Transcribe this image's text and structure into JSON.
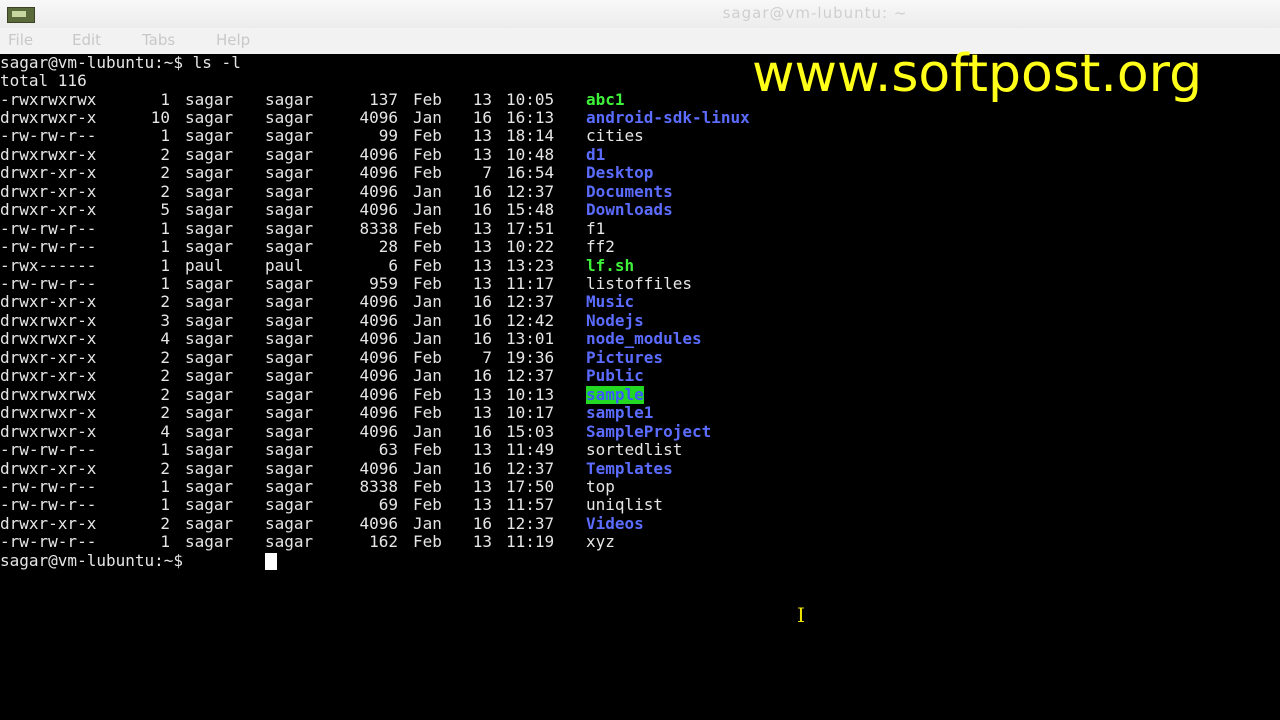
{
  "window": {
    "title": "sagar@vm-lubuntu: ~",
    "menu": [
      "File",
      "Edit",
      "Tabs",
      "Help"
    ]
  },
  "terminal": {
    "prompt_line": "sagar@vm-lubuntu:~$ ls -l",
    "total_line": "total 116",
    "entries": [
      {
        "perm": "-rwxrwxrwx",
        "links": "1",
        "owner": "sagar",
        "group": "sagar",
        "size": "137",
        "month": "Feb",
        "day": "13",
        "time": "10:05",
        "name": "abc1",
        "type": "exec"
      },
      {
        "perm": "drwxrwxr-x",
        "links": "10",
        "owner": "sagar",
        "group": "sagar",
        "size": "4096",
        "month": "Jan",
        "day": "16",
        "time": "16:13",
        "name": "android-sdk-linux",
        "type": "dir"
      },
      {
        "perm": "-rw-rw-r--",
        "links": "1",
        "owner": "sagar",
        "group": "sagar",
        "size": "99",
        "month": "Feb",
        "day": "13",
        "time": "18:14",
        "name": "cities",
        "type": "file"
      },
      {
        "perm": "drwxrwxr-x",
        "links": "2",
        "owner": "sagar",
        "group": "sagar",
        "size": "4096",
        "month": "Feb",
        "day": "13",
        "time": "10:48",
        "name": "d1",
        "type": "dir"
      },
      {
        "perm": "drwxr-xr-x",
        "links": "2",
        "owner": "sagar",
        "group": "sagar",
        "size": "4096",
        "month": "Feb",
        "day": "7",
        "time": "16:54",
        "name": "Desktop",
        "type": "dir"
      },
      {
        "perm": "drwxr-xr-x",
        "links": "2",
        "owner": "sagar",
        "group": "sagar",
        "size": "4096",
        "month": "Jan",
        "day": "16",
        "time": "12:37",
        "name": "Documents",
        "type": "dir"
      },
      {
        "perm": "drwxr-xr-x",
        "links": "5",
        "owner": "sagar",
        "group": "sagar",
        "size": "4096",
        "month": "Jan",
        "day": "16",
        "time": "15:48",
        "name": "Downloads",
        "type": "dir"
      },
      {
        "perm": "-rw-rw-r--",
        "links": "1",
        "owner": "sagar",
        "group": "sagar",
        "size": "8338",
        "month": "Feb",
        "day": "13",
        "time": "17:51",
        "name": "f1",
        "type": "file"
      },
      {
        "perm": "-rw-rw-r--",
        "links": "1",
        "owner": "sagar",
        "group": "sagar",
        "size": "28",
        "month": "Feb",
        "day": "13",
        "time": "10:22",
        "name": "ff2",
        "type": "file"
      },
      {
        "perm": "-rwx------",
        "links": "1",
        "owner": "paul",
        "group": "paul",
        "size": "6",
        "month": "Feb",
        "day": "13",
        "time": "13:23",
        "name": "lf.sh",
        "type": "exec"
      },
      {
        "perm": "-rw-rw-r--",
        "links": "1",
        "owner": "sagar",
        "group": "sagar",
        "size": "959",
        "month": "Feb",
        "day": "13",
        "time": "11:17",
        "name": "listoffiles",
        "type": "file"
      },
      {
        "perm": "drwxr-xr-x",
        "links": "2",
        "owner": "sagar",
        "group": "sagar",
        "size": "4096",
        "month": "Jan",
        "day": "16",
        "time": "12:37",
        "name": "Music",
        "type": "dir"
      },
      {
        "perm": "drwxrwxr-x",
        "links": "3",
        "owner": "sagar",
        "group": "sagar",
        "size": "4096",
        "month": "Jan",
        "day": "16",
        "time": "12:42",
        "name": "Nodejs",
        "type": "dir"
      },
      {
        "perm": "drwxrwxr-x",
        "links": "4",
        "owner": "sagar",
        "group": "sagar",
        "size": "4096",
        "month": "Jan",
        "day": "16",
        "time": "13:01",
        "name": "node_modules",
        "type": "dir"
      },
      {
        "perm": "drwxr-xr-x",
        "links": "2",
        "owner": "sagar",
        "group": "sagar",
        "size": "4096",
        "month": "Feb",
        "day": "7",
        "time": "19:36",
        "name": "Pictures",
        "type": "dir"
      },
      {
        "perm": "drwxr-xr-x",
        "links": "2",
        "owner": "sagar",
        "group": "sagar",
        "size": "4096",
        "month": "Jan",
        "day": "16",
        "time": "12:37",
        "name": "Public",
        "type": "dir"
      },
      {
        "perm": "drwxrwxrwx",
        "links": "2",
        "owner": "sagar",
        "group": "sagar",
        "size": "4096",
        "month": "Feb",
        "day": "13",
        "time": "10:13",
        "name": "sample",
        "type": "sticky"
      },
      {
        "perm": "drwxrwxr-x",
        "links": "2",
        "owner": "sagar",
        "group": "sagar",
        "size": "4096",
        "month": "Feb",
        "day": "13",
        "time": "10:17",
        "name": "sample1",
        "type": "dir"
      },
      {
        "perm": "drwxrwxr-x",
        "links": "4",
        "owner": "sagar",
        "group": "sagar",
        "size": "4096",
        "month": "Jan",
        "day": "16",
        "time": "15:03",
        "name": "SampleProject",
        "type": "dir"
      },
      {
        "perm": "-rw-rw-r--",
        "links": "1",
        "owner": "sagar",
        "group": "sagar",
        "size": "63",
        "month": "Feb",
        "day": "13",
        "time": "11:49",
        "name": "sortedlist",
        "type": "file"
      },
      {
        "perm": "drwxr-xr-x",
        "links": "2",
        "owner": "sagar",
        "group": "sagar",
        "size": "4096",
        "month": "Jan",
        "day": "16",
        "time": "12:37",
        "name": "Templates",
        "type": "dir"
      },
      {
        "perm": "-rw-rw-r--",
        "links": "1",
        "owner": "sagar",
        "group": "sagar",
        "size": "8338",
        "month": "Feb",
        "day": "13",
        "time": "17:50",
        "name": "top",
        "type": "file"
      },
      {
        "perm": "-rw-rw-r--",
        "links": "1",
        "owner": "sagar",
        "group": "sagar",
        "size": "69",
        "month": "Feb",
        "day": "13",
        "time": "11:57",
        "name": "uniqlist",
        "type": "file"
      },
      {
        "perm": "drwxr-xr-x",
        "links": "2",
        "owner": "sagar",
        "group": "sagar",
        "size": "4096",
        "month": "Jan",
        "day": "16",
        "time": "12:37",
        "name": "Videos",
        "type": "dir"
      },
      {
        "perm": "-rw-rw-r--",
        "links": "1",
        "owner": "sagar",
        "group": "sagar",
        "size": "162",
        "month": "Feb",
        "day": "13",
        "time": "11:19",
        "name": "xyz",
        "type": "file"
      }
    ],
    "final_prompt": "sagar@vm-lubuntu:~$ "
  },
  "watermark": "www.softpost.org",
  "colors": {
    "directory": "#5b6cff",
    "executable": "#3ef23a",
    "sticky_bg": "#22d822",
    "watermark": "#ffff1a"
  }
}
